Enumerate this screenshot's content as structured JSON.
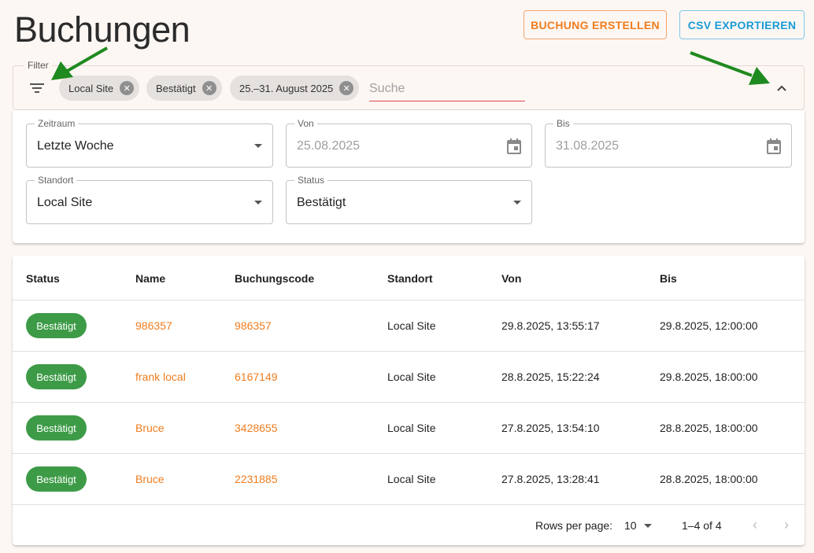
{
  "page": {
    "title": "Buchungen"
  },
  "actions": {
    "create_label": "BUCHUNG ERSTELLEN",
    "export_label": "CSV EXPORTIEREN"
  },
  "filter": {
    "legend": "Filter",
    "chips": [
      {
        "label": "Local Site"
      },
      {
        "label": "Bestätigt"
      },
      {
        "label": "25.–31. August 2025"
      }
    ],
    "search_placeholder": "Suche",
    "search_value": ""
  },
  "panel": {
    "zeitraum": {
      "label": "Zeitraum",
      "value": "Letzte Woche"
    },
    "von": {
      "label": "Von",
      "value": "25.08.2025"
    },
    "bis": {
      "label": "Bis",
      "value": "31.08.2025"
    },
    "standort": {
      "label": "Standort",
      "value": "Local Site"
    },
    "status": {
      "label": "Status",
      "value": "Bestätigt"
    }
  },
  "table": {
    "columns": [
      "Status",
      "Name",
      "Buchungscode",
      "Standort",
      "Von",
      "Bis"
    ],
    "rows": [
      {
        "status": "Bestätigt",
        "name": "986357",
        "code": "986357",
        "standort": "Local Site",
        "von": "29.8.2025, 13:55:17",
        "bis": "29.8.2025, 12:00:00"
      },
      {
        "status": "Bestätigt",
        "name": "frank local",
        "code": "6167149",
        "standort": "Local Site",
        "von": "28.8.2025, 15:22:24",
        "bis": "29.8.2025, 18:00:00"
      },
      {
        "status": "Bestätigt",
        "name": "Bruce",
        "code": "3428655",
        "standort": "Local Site",
        "von": "27.8.2025, 13:54:10",
        "bis": "28.8.2025, 18:00:00"
      },
      {
        "status": "Bestätigt",
        "name": "Bruce",
        "code": "2231885",
        "standort": "Local Site",
        "von": "27.8.2025, 13:28:41",
        "bis": "28.8.2025, 18:00:00"
      }
    ]
  },
  "pagination": {
    "rows_per_page_label": "Rows per page:",
    "rows_per_page": "10",
    "range": "1–4 of 4"
  },
  "colors": {
    "accent": "#ef7d1f",
    "export": "#1a9bd7",
    "badge": "#3d9b47",
    "search_underline": "#e0454e",
    "annotation_arrow": "#1f8a1f"
  }
}
